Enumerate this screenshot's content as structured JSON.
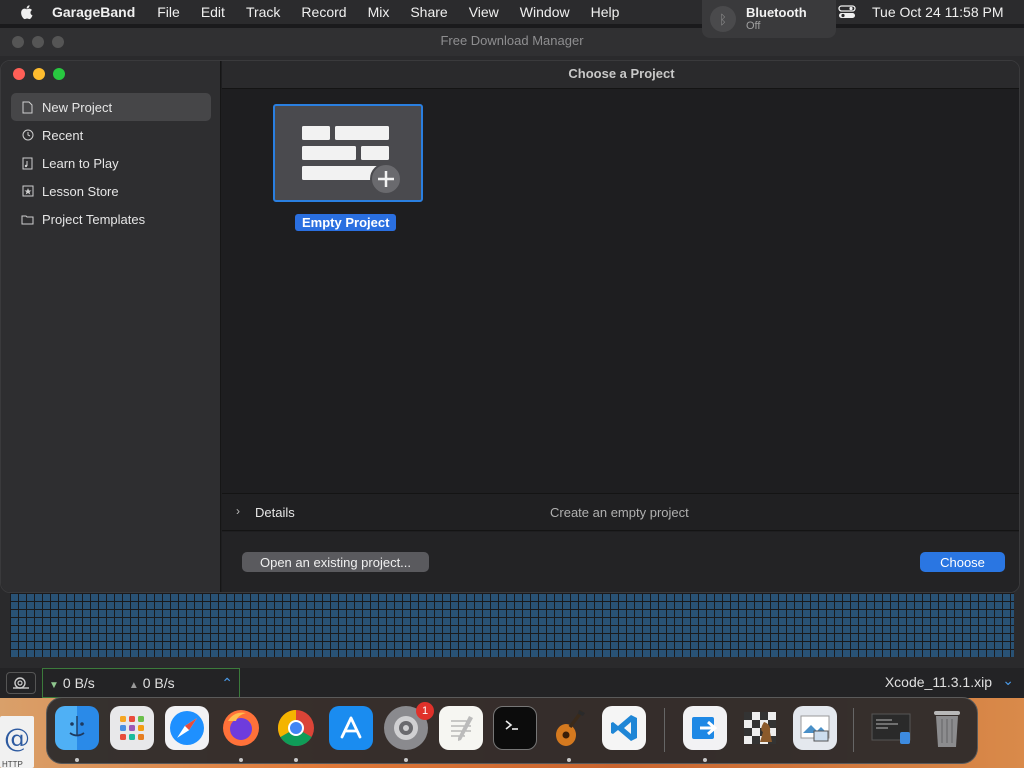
{
  "menubar": {
    "app_name": "GarageBand",
    "items": [
      "File",
      "Edit",
      "Track",
      "Record",
      "Mix",
      "Share",
      "View",
      "Window",
      "Help"
    ],
    "clock": "Tue Oct 24  11:58 PM",
    "bluetooth": {
      "title": "Bluetooth",
      "status": "Off"
    }
  },
  "fdm_window": {
    "title": "Free Download Manager",
    "download_speed": "0 B/s",
    "upload_speed": "0 B/s",
    "current_file": "Xcode_11.3.1.xip"
  },
  "gb_window": {
    "header": "Choose a Project",
    "sidebar": [
      {
        "label": "New Project",
        "icon": "document-icon",
        "active": true
      },
      {
        "label": "Recent",
        "icon": "clock-icon"
      },
      {
        "label": "Learn to Play",
        "icon": "music-book-icon"
      },
      {
        "label": "Lesson Store",
        "icon": "star-icon"
      },
      {
        "label": "Project Templates",
        "icon": "folder-icon"
      }
    ],
    "project": {
      "label": "Empty Project",
      "icon": "empty-project-icon"
    },
    "details": {
      "label": "Details",
      "description": "Create an empty project"
    },
    "footer": {
      "open_label": "Open an existing project...",
      "choose_label": "Choose"
    }
  },
  "desktop": {
    "icon_label": "HTTP"
  },
  "dock": {
    "apps": [
      {
        "name": "Finder",
        "icon": "finder-icon",
        "running": true
      },
      {
        "name": "Launchpad",
        "icon": "launchpad-icon",
        "running": false
      },
      {
        "name": "Safari",
        "icon": "safari-icon",
        "running": false
      },
      {
        "name": "Firefox",
        "icon": "firefox-icon",
        "running": true
      },
      {
        "name": "Chrome",
        "icon": "chrome-icon",
        "running": true
      },
      {
        "name": "App Store",
        "icon": "app-store-icon",
        "running": false
      },
      {
        "name": "System Preferences",
        "icon": "system-preferences-icon",
        "running": true,
        "badge": "1"
      },
      {
        "name": "TextEdit",
        "icon": "textedit-icon",
        "running": false
      },
      {
        "name": "Terminal",
        "icon": "terminal-icon",
        "running": false
      },
      {
        "name": "GarageBand",
        "icon": "garageband-icon",
        "running": true
      },
      {
        "name": "Visual Studio Code",
        "icon": "vscode-icon",
        "running": false
      },
      {
        "name": "Free Download Manager",
        "icon": "fdm-icon",
        "running": true
      },
      {
        "name": "Chess",
        "icon": "chess-icon",
        "running": false
      },
      {
        "name": "Preview",
        "icon": "preview-icon",
        "running": false
      },
      {
        "name": "Screenshot",
        "icon": "screenshot-icon",
        "running": false
      },
      {
        "name": "Trash",
        "icon": "trash-icon",
        "running": false
      }
    ]
  }
}
